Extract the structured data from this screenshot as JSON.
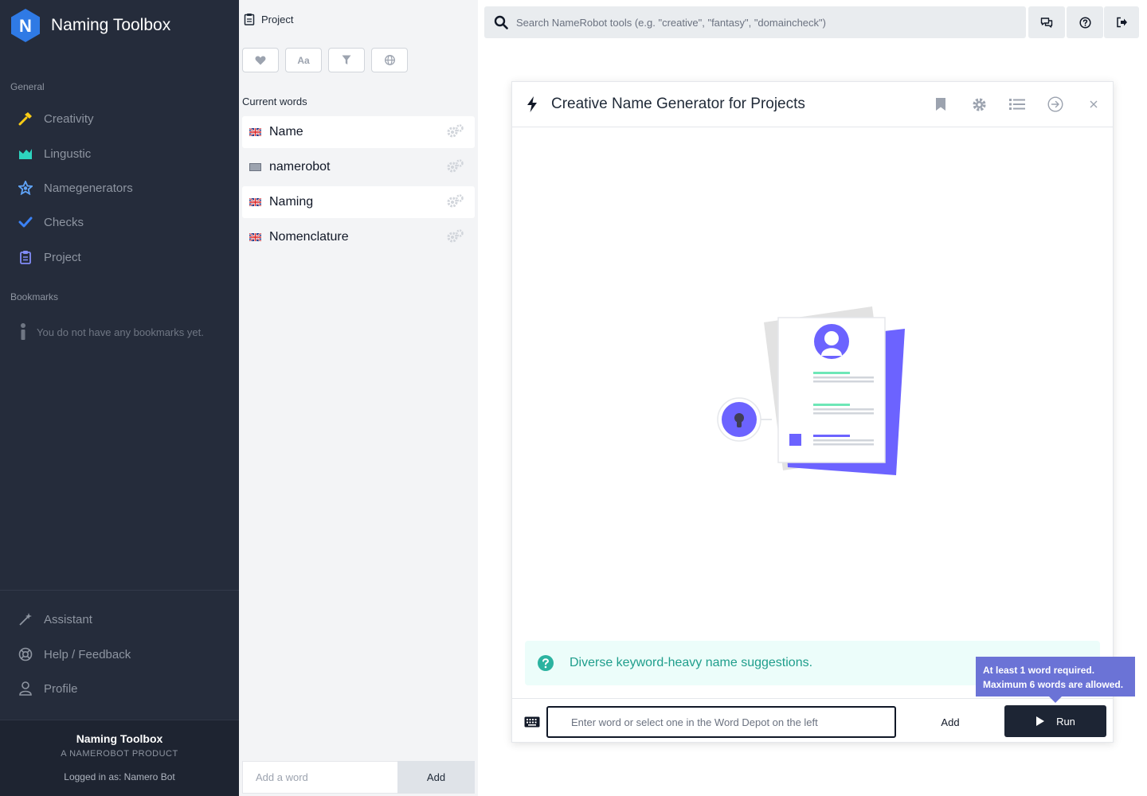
{
  "sidebar": {
    "brand": {
      "logo_letter": "N",
      "name": "Naming Toolbox"
    },
    "general_label": "General",
    "nav": [
      {
        "label": "Creativity",
        "icon": "hammer-icon",
        "color": "#facc15"
      },
      {
        "label": "Lingustic",
        "icon": "chart-icon",
        "color": "#2dd4bf"
      },
      {
        "label": "Namegenerators",
        "icon": "star-badge-icon",
        "color": "#60a5fa"
      },
      {
        "label": "Checks",
        "icon": "check-icon",
        "color": "#3b82f6"
      },
      {
        "label": "Project",
        "icon": "clipboard-icon",
        "color": "#818cf8"
      }
    ],
    "bookmarks_label": "Bookmarks",
    "bookmarks_empty": "You do not have any bookmarks yet.",
    "bottom_nav": [
      {
        "label": "Assistant",
        "icon": "magic-wand-icon"
      },
      {
        "label": "Help / Feedback",
        "icon": "lifebuoy-icon"
      },
      {
        "label": "Profile",
        "icon": "user-icon"
      }
    ],
    "footer": {
      "title": "Naming Toolbox",
      "subtitle": "A NAMEROBOT PRODUCT",
      "logged_in": "Logged in as: Namero Bot"
    }
  },
  "depot": {
    "header": "Project",
    "tools": [
      {
        "icon": "heart-icon"
      },
      {
        "icon": "font-icon",
        "text": "Aa"
      },
      {
        "icon": "filter-icon"
      },
      {
        "icon": "globe-icon"
      }
    ],
    "current_words_label": "Current words",
    "words": [
      {
        "text": "Name",
        "flag": "uk-flag",
        "highlighted": true
      },
      {
        "text": "namerobot",
        "flag": "unknown-flag",
        "highlighted": false
      },
      {
        "text": "Naming",
        "flag": "uk-flag",
        "highlighted": true
      },
      {
        "text": "Nomenclature",
        "flag": "uk-flag",
        "highlighted": false
      }
    ],
    "add_placeholder": "Add a word",
    "add_button": "Add"
  },
  "search": {
    "placeholder": "Search NameRobot tools (e.g. \"creative\", \"fantasy\", \"domaincheck\")"
  },
  "top_actions": [
    {
      "icon": "chat-icon"
    },
    {
      "icon": "help-icon"
    },
    {
      "icon": "logout-icon"
    }
  ],
  "tool": {
    "title": "Creative Name Generator for Projects",
    "info_text": "Diverse keyword-heavy name suggestions.",
    "input_placeholder": "Enter word or select one in the Word Depot on the left",
    "add_label": "Add",
    "run_label": "Run",
    "tooltip_line1": "At least 1 word required.",
    "tooltip_line2": "Maximum 6 words are allowed."
  },
  "colors": {
    "sidebar_bg": "#252c3b",
    "accent_purple": "#6c63ff",
    "info_teal": "#1f9e8c",
    "run_bg": "#1d2534",
    "tooltip_bg": "#6b73d6"
  }
}
